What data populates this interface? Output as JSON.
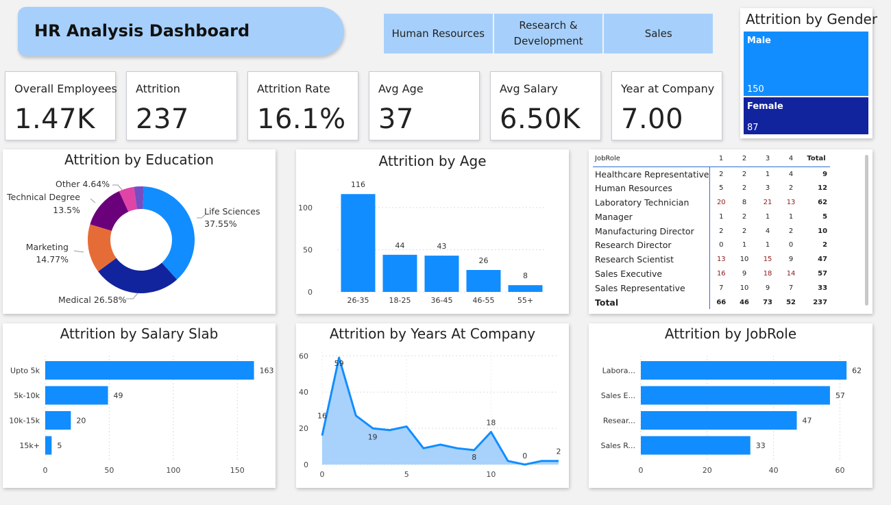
{
  "header": {
    "title": "HR Analysis Dashboard"
  },
  "departments": [
    "Human Resources",
    "Research & Development",
    "Sales"
  ],
  "kpis": [
    {
      "label": "Overall Employees",
      "value": "1.47K"
    },
    {
      "label": "Attrition",
      "value": "237"
    },
    {
      "label": "Attrition Rate",
      "value": "16.1%"
    },
    {
      "label": "Avg Age",
      "value": "37"
    },
    {
      "label": "Avg Salary",
      "value": "6.50K"
    },
    {
      "label": "Year at Company",
      "value": "7.00"
    }
  ],
  "gender": {
    "title": "Attrition by Gender",
    "items": [
      {
        "name": "Male",
        "value": "150",
        "color": "#118dff"
      },
      {
        "name": "Female",
        "value": "87",
        "color": "#12239e"
      }
    ]
  },
  "colors": {
    "accent": "#118dff",
    "area_fill": "#a8d2fc",
    "banner": "#a6d0fb"
  },
  "chart_data": [
    {
      "type": "pie",
      "title": "Attrition by Education",
      "donut": true,
      "slices": [
        {
          "name": "Life Sciences",
          "percent": "37.55%",
          "value": 37.55,
          "color": "#118dff"
        },
        {
          "name": "Medical",
          "percent": "26.58%",
          "value": 26.58,
          "color": "#12239e"
        },
        {
          "name": "Marketing",
          "percent": "14.77%",
          "value": 14.77,
          "color": "#e66c37"
        },
        {
          "name": "Technical Degree",
          "percent": "13.5%",
          "value": 13.5,
          "color": "#6b007b"
        },
        {
          "name": "Other",
          "percent": "4.64%",
          "value": 4.64,
          "color": "#e044a7"
        },
        {
          "name": "",
          "percent": "",
          "value": 2.96,
          "color": "#744ec2"
        }
      ]
    },
    {
      "type": "bar",
      "title": "Attrition by Age",
      "categories": [
        "26-35",
        "18-25",
        "36-45",
        "46-55",
        "55+"
      ],
      "values": [
        116,
        44,
        43,
        26,
        8
      ],
      "ylim": [
        0,
        130
      ],
      "yticks": [
        0,
        50,
        100
      ],
      "grid": true
    },
    {
      "type": "bar",
      "orientation": "horizontal",
      "title": "Attrition by Salary Slab",
      "categories": [
        "Upto 5k",
        "5k-10k",
        "10k-15k",
        "15k+"
      ],
      "values": [
        163,
        49,
        20,
        5
      ],
      "xlim": [
        0,
        175
      ],
      "xticks": [
        0,
        50,
        100,
        150
      ],
      "grid": true
    },
    {
      "type": "area",
      "title": "Attrition by Years At Company",
      "x": [
        0,
        1,
        2,
        3,
        4,
        5,
        6,
        7,
        8,
        9,
        10,
        11,
        12,
        13,
        14
      ],
      "values": [
        16,
        59,
        27,
        20,
        19,
        21,
        9,
        11,
        9,
        8,
        18,
        2,
        0,
        2,
        2
      ],
      "labeled": [
        0,
        1,
        4,
        9,
        10,
        12,
        14
      ],
      "ylim": [
        0,
        62
      ],
      "yticks": [
        0,
        20,
        40,
        60
      ],
      "xticks": [
        0,
        5,
        10
      ],
      "grid": true
    },
    {
      "type": "bar",
      "orientation": "horizontal",
      "title": "Attrition by JobRole",
      "categories": [
        "Labora...",
        "Sales E...",
        "Resear...",
        "Sales R..."
      ],
      "values": [
        62,
        57,
        47,
        33
      ],
      "xlim": [
        0,
        63
      ],
      "xticks": [
        0,
        20,
        40,
        60
      ],
      "grid": true
    },
    {
      "type": "table",
      "title": "",
      "columns": [
        "JobRole",
        "1",
        "2",
        "3",
        "4",
        "Total"
      ],
      "rows": [
        {
          "role": "Healthcare Representative",
          "vals": [
            "2",
            "2",
            "1",
            "4"
          ],
          "total": "9"
        },
        {
          "role": "Human Resources",
          "vals": [
            "5",
            "2",
            "3",
            "2"
          ],
          "total": "12"
        },
        {
          "role": "Laboratory Technician",
          "vals": [
            "20",
            "8",
            "21",
            "13"
          ],
          "total": "62"
        },
        {
          "role": "Manager",
          "vals": [
            "1",
            "2",
            "1",
            "1"
          ],
          "total": "5"
        },
        {
          "role": "Manufacturing Director",
          "vals": [
            "2",
            "2",
            "4",
            "2"
          ],
          "total": "10"
        },
        {
          "role": "Research Director",
          "vals": [
            "0",
            "1",
            "1",
            "0"
          ],
          "total": "2"
        },
        {
          "role": "Research Scientist",
          "vals": [
            "13",
            "10",
            "15",
            "9"
          ],
          "total": "47"
        },
        {
          "role": "Sales Executive",
          "vals": [
            "16",
            "9",
            "18",
            "14"
          ],
          "total": "57"
        },
        {
          "role": "Sales Representative",
          "vals": [
            "7",
            "10",
            "9",
            "7"
          ],
          "total": "33"
        }
      ],
      "total_row": {
        "role": "Total",
        "vals": [
          "66",
          "46",
          "73",
          "52"
        ],
        "total": "237"
      },
      "highlight_color": "#8b1a1a"
    }
  ]
}
